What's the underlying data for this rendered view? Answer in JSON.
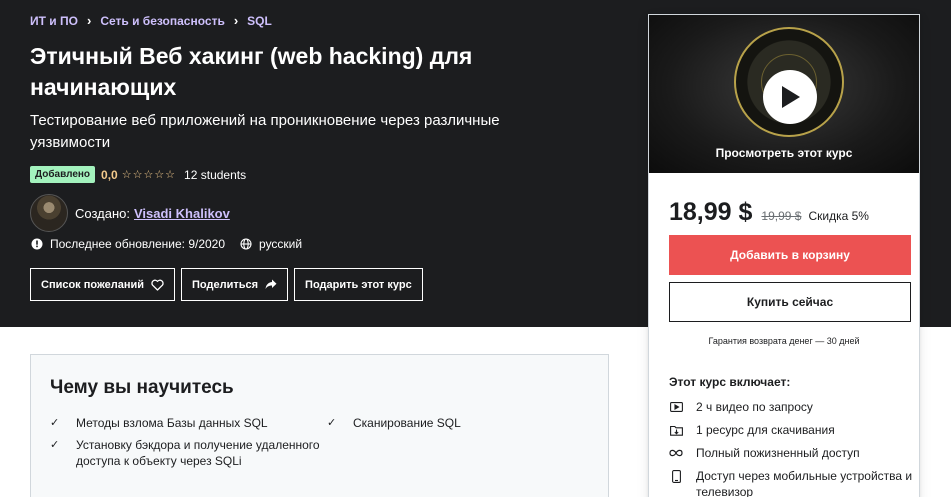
{
  "breadcrumb": [
    {
      "label": "ИТ и ПО"
    },
    {
      "label": "Сеть и безопасность"
    },
    {
      "label": "SQL"
    }
  ],
  "course": {
    "title": "Этичный Веб хакинг (web hacking) для начинающих",
    "subtitle": "Тестирование веб приложений на проникновение через различные уязвимости",
    "badge": "Добавлено",
    "rating": "0,0",
    "stars": "☆☆☆☆☆",
    "students": "12 students",
    "created_label": "Создано:",
    "author": "Visadi Khalikov",
    "updated": "Последнее обновление: 9/2020",
    "language": "русский"
  },
  "actions": {
    "wishlist": "Список пожеланий",
    "share": "Поделиться",
    "gift": "Подарить этот курс"
  },
  "sidebar": {
    "preview_label": "Просмотреть этот курс",
    "price": "18,99 $",
    "old_price": "19,99 $",
    "discount": "Скидка 5%",
    "add_to_cart": "Добавить в корзину",
    "buy_now": "Купить сейчас",
    "guarantee": "Гарантия возврата денег — 30 дней",
    "includes_title": "Этот курс включает:",
    "includes": [
      {
        "icon": "video-icon",
        "label": "2 ч видео по запросу"
      },
      {
        "icon": "file-icon",
        "label": "1 ресурс для скачивания"
      },
      {
        "icon": "infinity-icon",
        "label": "Полный пожизненный доступ"
      },
      {
        "icon": "mobile-icon",
        "label": "Доступ через мобильные устройства и телевизор"
      }
    ]
  },
  "learn": {
    "title": "Чему вы научитесь",
    "items": [
      "Методы взлома Базы данных SQL",
      "Сканирование SQL",
      "Установку бэкдора и получение удаленного доступа к объекту через SQLi"
    ]
  },
  "colors": {
    "hero_bg": "#1c1d1f",
    "link": "#cec0fc",
    "star": "#f3ca8c",
    "badge": "#a3f2bd",
    "cart": "#ec5252"
  }
}
